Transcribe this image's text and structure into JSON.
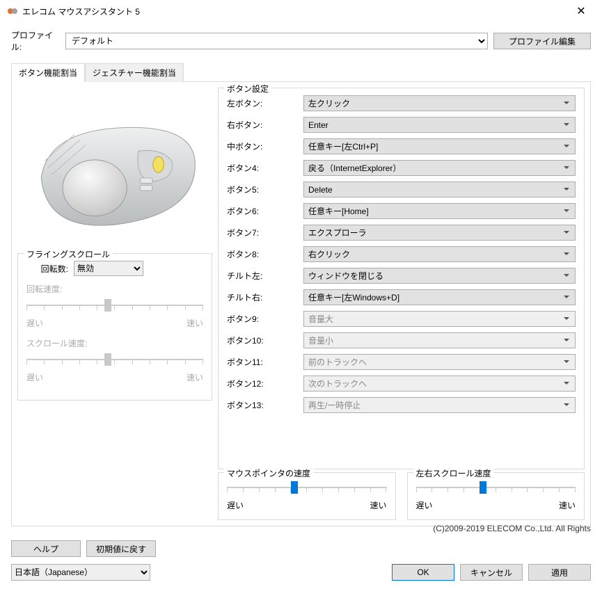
{
  "window": {
    "title": "エレコム マウスアシスタント 5"
  },
  "profile": {
    "label": "プロファイル:",
    "selected": "デフォルト",
    "edit_button": "プロファイル編集"
  },
  "tabs": {
    "button_assign": "ボタン機能割当",
    "gesture_assign": "ジェスチャー機能割当"
  },
  "flying_scroll": {
    "legend": "フライングスクロール",
    "rotations_label": "回転数:",
    "rotations_value": "無効",
    "rotation_speed_label": "回転速度:",
    "scroll_speed_label": "スクロール速度:",
    "slow": "遅い",
    "fast": "速い"
  },
  "button_settings": {
    "legend": "ボタン設定",
    "rows": [
      {
        "label": "左ボタン:",
        "value": "左クリック",
        "enabled": true
      },
      {
        "label": "右ボタン:",
        "value": "Enter",
        "enabled": true
      },
      {
        "label": "中ボタン:",
        "value": "任意キー[左Ctrl+P]",
        "enabled": true
      },
      {
        "label": "ボタン4:",
        "value": "戻る（InternetExplorer）",
        "enabled": true
      },
      {
        "label": "ボタン5:",
        "value": "Delete",
        "enabled": true
      },
      {
        "label": "ボタン6:",
        "value": "任意キー[Home]",
        "enabled": true
      },
      {
        "label": "ボタン7:",
        "value": "エクスプローラ",
        "enabled": true
      },
      {
        "label": "ボタン8:",
        "value": "右クリック",
        "enabled": true
      },
      {
        "label": "チルト左:",
        "value": "ウィンドウを閉じる",
        "enabled": true
      },
      {
        "label": "チルト右:",
        "value": "任意キー[左Windows+D]",
        "enabled": true
      },
      {
        "label": "ボタン9:",
        "value": "音量大",
        "enabled": false
      },
      {
        "label": "ボタン10:",
        "value": "音量小",
        "enabled": false
      },
      {
        "label": "ボタン11:",
        "value": "前のトラックへ",
        "enabled": false
      },
      {
        "label": "ボタン12:",
        "value": "次のトラックへ",
        "enabled": false
      },
      {
        "label": "ボタン13:",
        "value": "再生/一時停止",
        "enabled": false
      }
    ]
  },
  "pointer_speed": {
    "legend": "マウスポインタの速度",
    "slow": "遅い",
    "fast": "速い"
  },
  "hscroll_speed": {
    "legend": "左右スクロール速度",
    "slow": "遅い",
    "fast": "速い"
  },
  "copyright": "(C)2009-2019 ELECOM Co.,Ltd. All Rights",
  "footer": {
    "help": "ヘルプ",
    "reset": "初期値に戻す",
    "language": "日本語（Japanese）",
    "ok": "OK",
    "cancel": "キャンセル",
    "apply": "適用"
  }
}
